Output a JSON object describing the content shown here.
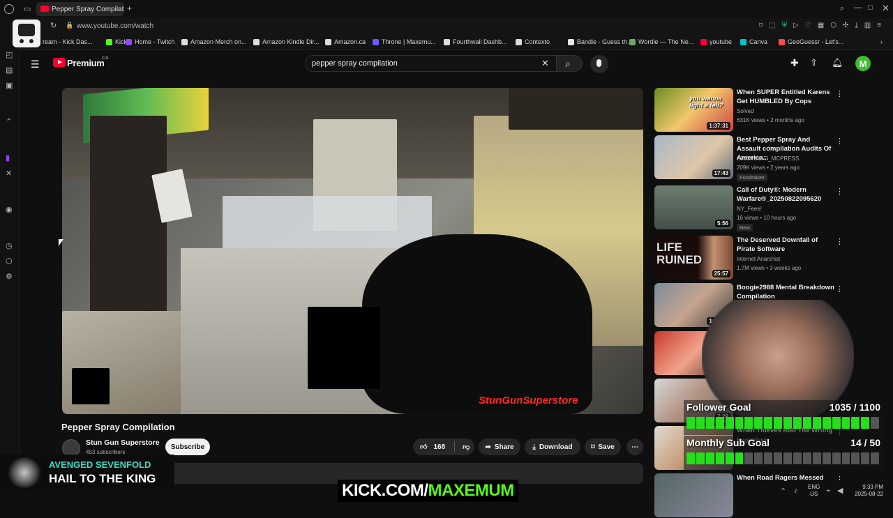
{
  "browser": {
    "tab_title": "Pepper Spray Compilation",
    "new_tab": "+",
    "url": "www.youtube.com/watch",
    "bookmarks": [
      {
        "label": "ream - Kick Das...",
        "color": "#53fc18"
      },
      {
        "label": "Kick",
        "color": "#53fc18"
      },
      {
        "label": "Home - Twitch",
        "color": "#9146ff"
      },
      {
        "label": "Amazon Merch on...",
        "color": "#dddddd"
      },
      {
        "label": "Amazon Kindle Dir...",
        "color": "#dddddd"
      },
      {
        "label": "Amazon.ca",
        "color": "#dddddd"
      },
      {
        "label": "Throne | Maxemu...",
        "color": "#6b5bff"
      },
      {
        "label": "Fourthwall Dashb...",
        "color": "#dddddd"
      },
      {
        "label": "Contexto",
        "color": "#dddddd"
      },
      {
        "label": "Bandle - Guess th...",
        "color": "#e8e8e8"
      },
      {
        "label": "Wordle — The Ne...",
        "color": "#6aaa64"
      },
      {
        "label": "youtube",
        "color": "#ff0033"
      },
      {
        "label": "Canva",
        "color": "#00c4cc"
      },
      {
        "label": "GeoGuessr - Let's...",
        "color": "#ff4b4b"
      }
    ]
  },
  "youtube": {
    "logo": "Premium",
    "logo_region": "CA",
    "search_query": "pepper spray compilation",
    "avatar_letter": "M",
    "video": {
      "watermark": "StunGunSuperstore",
      "title": "Pepper Spray Compilation",
      "channel": "Stun Gun Superstore",
      "subscribers": "453 subscribers",
      "subscribe": "Subscribe",
      "likes": "168",
      "share": "Share",
      "download": "Download",
      "save": "Save"
    },
    "recommendations": [
      {
        "title": "When SUPER Entitled Karens Get HUMBLED By Cops",
        "channel": "Solved",
        "meta": "631K views • 2 months ago",
        "duration": "1:37:31",
        "thumb_text": "you wanna fight a felt?",
        "badge": ""
      },
      {
        "title": "Best Pepper Spray And Assault compilation Audits Of America...",
        "channel": "CINCINNATI_MCPRESS",
        "meta": "209K views • 2 years ago",
        "duration": "17:43",
        "thumb_text": "",
        "badge": "Fundraiser"
      },
      {
        "title": "Call of Duty®: Modern Warfare®_20250822095620",
        "channel": "NY_Feee!",
        "meta": "16 views • 10 hours ago",
        "duration": "5:56",
        "thumb_text": "",
        "badge": "New"
      },
      {
        "title": "The Deserved Downfall of Pirate Software",
        "channel": "Internet Anarchist",
        "meta": "1.7M views • 3 weeks ago",
        "duration": "25:57",
        "thumb_text": "LIFE RUINED",
        "badge": ""
      },
      {
        "title": "Boogie2988 Mental Breakdown Compilation",
        "channel": "Breaki",
        "meta": "60",
        "duration": "1:24:40",
        "thumb_text": "",
        "badge": ""
      },
      {
        "title": "I",
        "channel": "",
        "meta": "",
        "duration": "12:1",
        "thumb_text": "",
        "badge": ""
      },
      {
        "title": "",
        "channel": "",
        "meta": "s • 5 months ago",
        "duration": "7:29",
        "thumb_text": "",
        "badge": ""
      },
      {
        "title": "When Thieves Rob The Wrong",
        "channel": "Binge Watch",
        "meta": "",
        "duration": "",
        "thumb_text": "",
        "badge": ""
      },
      {
        "title": "When Road Ragers Messed",
        "channel": "",
        "meta": "",
        "duration": "",
        "thumb_text": "",
        "badge": ""
      }
    ],
    "rec_extra_title": "mb"
  },
  "overlay": {
    "follower_goal": {
      "label": "Follower Goal",
      "value": "1035 / 1100",
      "progress": 0.94
    },
    "sub_goal": {
      "label": "Monthly Sub Goal",
      "value": "14 / 50",
      "progress": 0.28
    },
    "music_artist": "AVENGED SEVENFOLD",
    "music_song": "HAIL TO THE KING",
    "kick_left": "KICK.COM/",
    "kick_right": "MAXEMUM"
  },
  "taskbar": {
    "lang": "ENG",
    "region": "US",
    "time": "9:33 PM",
    "date": "2025-08-22"
  },
  "colors": {
    "accent_red": "#ff0033",
    "goal_green": "#24e01a",
    "kick_green": "#53fc18",
    "watermark": "#ff2a2a"
  }
}
